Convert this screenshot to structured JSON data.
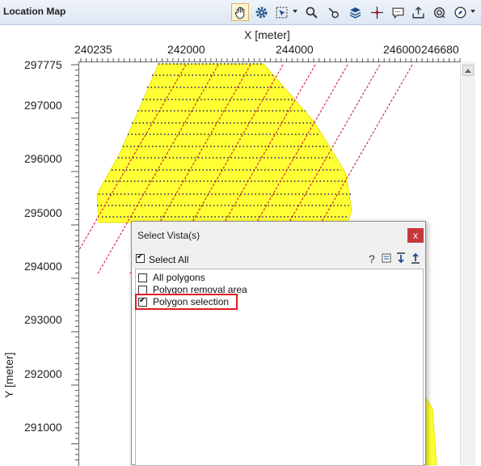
{
  "window": {
    "title": "Location Map"
  },
  "toolbar": {
    "tools": [
      {
        "name": "pan",
        "icon": "hand-icon",
        "active": true
      },
      {
        "name": "settings",
        "icon": "gear-icon"
      },
      {
        "name": "select",
        "icon": "select-rect-icon",
        "has_dropdown": true
      },
      {
        "name": "zoom",
        "icon": "magnifier-icon"
      },
      {
        "name": "pick",
        "icon": "pick-icon"
      },
      {
        "name": "layers",
        "icon": "layers-icon"
      },
      {
        "name": "crosshair",
        "icon": "crosshair-icon"
      },
      {
        "name": "comment",
        "icon": "comment-icon"
      },
      {
        "name": "export",
        "icon": "export-icon"
      },
      {
        "name": "target",
        "icon": "target-icon"
      },
      {
        "name": "compass",
        "icon": "compass-icon",
        "has_dropdown": true
      }
    ]
  },
  "map": {
    "x_axis": {
      "label": "X [meter]",
      "ticks": [
        "240235",
        "242000",
        "244000",
        "246000",
        "246680"
      ]
    },
    "y_axis": {
      "label": "Y [meter]",
      "ticks": [
        "297775",
        "297000",
        "296000",
        "295000",
        "294000",
        "293000",
        "292000",
        "291000"
      ]
    },
    "colors": {
      "polygon_fill": "#ffff33",
      "line_dots": "#1a1a6e",
      "line_dashes": "#c8102e"
    }
  },
  "dialog": {
    "title": "Select Vista(s)",
    "close_label": "x",
    "select_all": {
      "label": "Select All",
      "checked": true
    },
    "icons": [
      "help-icon",
      "list-icon",
      "download-icon",
      "upload-icon"
    ],
    "help_label": "?",
    "items": [
      {
        "label": "All polygons",
        "checked": false
      },
      {
        "label": "Polygon removal area",
        "checked": false
      },
      {
        "label": "Polygon selection",
        "checked": true,
        "highlighted": true
      }
    ]
  }
}
